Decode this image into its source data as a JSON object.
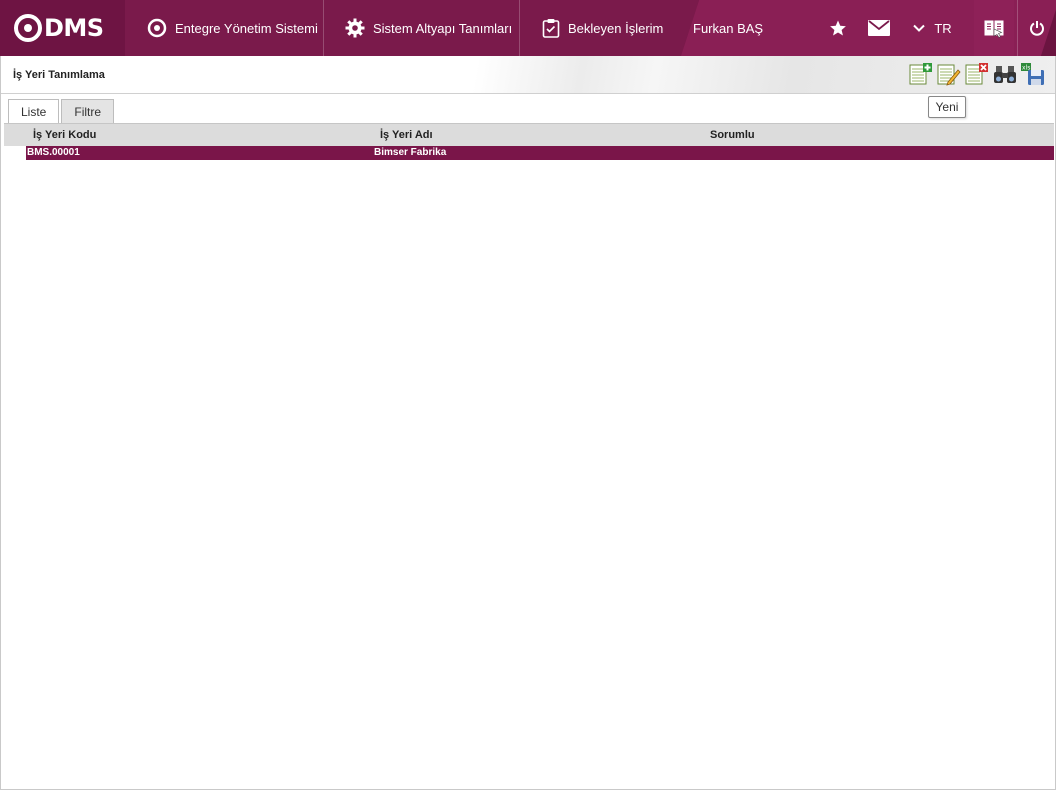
{
  "topbar": {
    "logo_text": "DMS",
    "nav": [
      {
        "label": "Entegre Yönetim Sistemi",
        "icon": "qdms-circle-icon"
      },
      {
        "label": "Sistem Altyapı Tanımları",
        "icon": "gear-icon"
      },
      {
        "label": "Bekleyen İşlerim",
        "icon": "clipboard-icon"
      }
    ],
    "user_name": "Furkan BAŞ",
    "language": "TR",
    "icons": [
      "star-icon",
      "mail-icon",
      "chevron-down-icon",
      "book-icon",
      "power-icon"
    ]
  },
  "page": {
    "title": "İş Yeri Tanımlama",
    "toolbar": [
      "new-record-icon",
      "edit-record-icon",
      "delete-record-icon",
      "search-binoculars-icon",
      "export-excel-icon"
    ],
    "tooltip": "Yeni"
  },
  "tabs": [
    {
      "label": "Liste",
      "active": true
    },
    {
      "label": "Filtre",
      "active": false
    }
  ],
  "grid": {
    "columns": [
      "İş Yeri Kodu",
      "İş Yeri Adı",
      "Sorumlu"
    ],
    "rows": [
      {
        "code": "BMS.00001",
        "name": "Bimser Fabrika",
        "responsible": ""
      }
    ]
  },
  "colors": {
    "brand": "#6b1440",
    "selected_row": "#7a1549"
  }
}
